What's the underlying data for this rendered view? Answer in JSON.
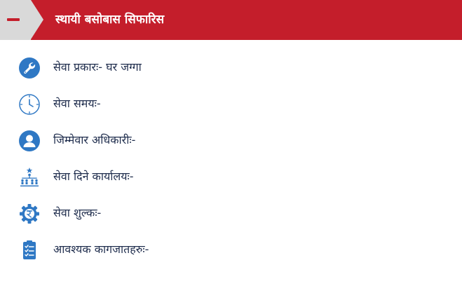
{
  "header": {
    "title": "स्थायी बसोबास सिफारिस",
    "toggle_icon": "minus-icon"
  },
  "colors": {
    "header_bg": "#c41e2b",
    "toggle_bg": "#d9d9d9",
    "icon_blue": "#2f78c4",
    "label_text": "#1f2d4d"
  },
  "items": [
    {
      "icon": "wrench-icon",
      "label": "सेवा प्रकारः- घर जग्गा"
    },
    {
      "icon": "clock-icon",
      "label": "सेवा समयः-"
    },
    {
      "icon": "user-icon",
      "label": "जिम्मेवार अधिकारीः-"
    },
    {
      "icon": "org-chart-icon",
      "label": "सेवा दिने कार्यालयः-"
    },
    {
      "icon": "rupee-gear-icon",
      "label": "सेवा शुल्कः-"
    },
    {
      "icon": "checklist-icon",
      "label": "आवश्यक कागजातहरुः-"
    }
  ]
}
